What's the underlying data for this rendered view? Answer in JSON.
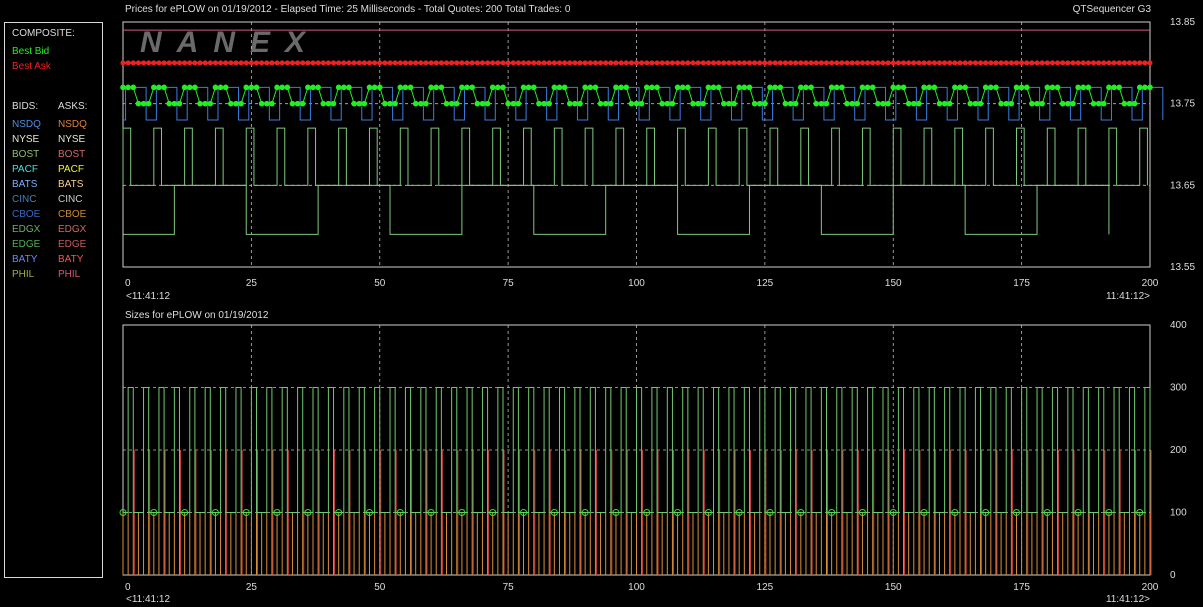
{
  "header": {
    "title": "Prices for  ePLOW  on  01/19/2012  -  Elapsed Time: 25 Milliseconds  -  Total Quotes: 200  Total Trades: 0",
    "app_name": "QTSequencer G3",
    "sizes_title": "Sizes for  ePLOW  on  01/19/2012",
    "watermark": "NANEX"
  },
  "legend": {
    "composite_label": "COMPOSITE:",
    "best_bid_label": "Best Bid",
    "best_ask_label": "Best Ask",
    "bids_header": "BIDS:",
    "asks_header": "ASKS:",
    "exchanges": [
      {
        "bid": "NSDQ",
        "ask": "NSDQ",
        "bid_color": "#4f8fe0",
        "ask_color": "#e0803a"
      },
      {
        "bid": "NYSE",
        "ask": "NYSE",
        "bid_color": "#e8e8d0",
        "ask_color": "#e8e8d0"
      },
      {
        "bid": "BOST",
        "ask": "BOST",
        "bid_color": "#8fbf6f",
        "ask_color": "#d26a6a"
      },
      {
        "bid": "PACF",
        "ask": "PACF",
        "bid_color": "#48e0e0",
        "ask_color": "#f0f040"
      },
      {
        "bid": "BATS",
        "ask": "BATS",
        "bid_color": "#7ab0ff",
        "ask_color": "#ffd090"
      },
      {
        "bid": "CINC",
        "ask": "CINC",
        "bid_color": "#4a7fb0",
        "ask_color": "#cccccc"
      },
      {
        "bid": "CBOE",
        "ask": "CBOE",
        "bid_color": "#3a68c0",
        "ask_color": "#c98a3a"
      },
      {
        "bid": "EDGX",
        "ask": "EDGX",
        "bid_color": "#6ab06a",
        "ask_color": "#d06a5a"
      },
      {
        "bid": "EDGE",
        "ask": "EDGE",
        "bid_color": "#50b050",
        "ask_color": "#c85a5a"
      },
      {
        "bid": "BATY",
        "ask": "BATY",
        "bid_color": "#6a8aff",
        "ask_color": "#ff5050"
      },
      {
        "bid": "PHIL",
        "ask": "PHIL",
        "bid_color": "#9ab04a",
        "ask_color": "#d05a7a"
      }
    ],
    "colors": {
      "best_bid": "#22ee22",
      "best_ask": "#ee2222",
      "label": "#dddddd"
    }
  },
  "chart_data": [
    {
      "type": "line",
      "title": "Prices for  ePLOW  on  01/19/2012  -  Elapsed Time: 25 Milliseconds  -  Total Quotes: 200  Total Trades: 0",
      "xlim": [
        0,
        200
      ],
      "ylim": [
        13.55,
        13.85
      ],
      "x_ticks": [
        "0",
        "25",
        "50",
        "75",
        "100",
        "125",
        "150",
        "175",
        "200"
      ],
      "y_ticks": [
        "13.55",
        "13.65",
        "13.75",
        "13.85"
      ],
      "start_time": "<11:41:12",
      "end_time": "11:41:12>",
      "grid": true,
      "series": [
        {
          "name": "Best Ask",
          "color": "#ee2222",
          "values": [
            13.8
          ]
        },
        {
          "name": "Best Bid",
          "color": "#22ee22",
          "values_pattern": [
            13.77,
            13.77,
            13.77,
            13.75,
            13.75,
            13.75
          ]
        }
      ],
      "reference_line": 13.84,
      "blue_levels": [
        13.77,
        13.73
      ],
      "green_levels": [
        13.65,
        13.59
      ]
    },
    {
      "type": "bar",
      "title": "Sizes for  ePLOW  on  01/19/2012",
      "xlim": [
        0,
        200
      ],
      "ylim": [
        0,
        400
      ],
      "x_ticks": [
        "0",
        "25",
        "50",
        "75",
        "100",
        "125",
        "150",
        "175",
        "200"
      ],
      "y_ticks": [
        "0",
        "100",
        "200",
        "300",
        "400"
      ],
      "start_time": "<11:41:12",
      "end_time": "11:41:12>",
      "grid": true,
      "bid_size_peak": 300,
      "ask_size_peak": 200,
      "base_size": 100
    }
  ]
}
